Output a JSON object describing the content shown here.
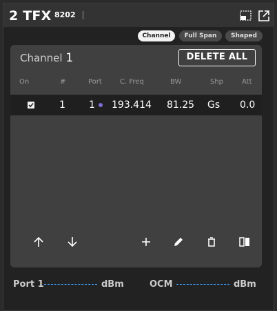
{
  "title": {
    "main": "2 TFX",
    "model": "8202"
  },
  "window_icons": [
    "restore-icon",
    "popout-icon"
  ],
  "modes": [
    {
      "label": "Channel",
      "active": true
    },
    {
      "label": "Full Span",
      "active": false
    },
    {
      "label": "Shaped",
      "active": false
    }
  ],
  "panel": {
    "title_prefix": "Channel",
    "title_number": "1",
    "delete_label": "DELETE ALL"
  },
  "columns": [
    "On",
    "#",
    "Port",
    "C. Freq",
    "BW",
    "Shp",
    "Att"
  ],
  "rows": [
    {
      "on": true,
      "num": "1",
      "port": "1",
      "freq": "193.414",
      "bw": "81.25",
      "shp": "Gs",
      "att": "0.0"
    }
  ],
  "toolbar_icons": [
    "arrow-up-icon",
    "arrow-down-icon",
    "plus-icon",
    "pencil-icon",
    "trash-icon",
    "split-view-icon"
  ],
  "readouts": {
    "port_label": "Port 1",
    "port_unit": "dBm",
    "ocm_label": "OCM",
    "ocm_unit": "dBm"
  },
  "colors": {
    "accent_dashes": "#3aa0ff",
    "port_dot": "#7b6fd6"
  }
}
